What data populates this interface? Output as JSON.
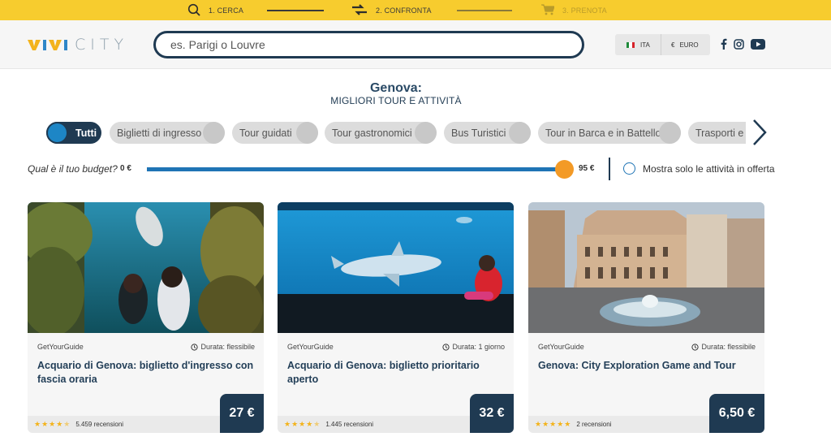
{
  "steps": [
    {
      "label": "1. CERCA",
      "icon": "search-icon"
    },
    {
      "label": "2. CONFRONTA",
      "icon": "compare-arrows-icon"
    },
    {
      "label": "3. PRENOTA",
      "icon": "cart-icon"
    }
  ],
  "logo": {
    "text": "CITY"
  },
  "search": {
    "placeholder": "es. Parigi o Louvre",
    "value": ""
  },
  "language": {
    "label": "ITA",
    "icon": "italy-flag-icon"
  },
  "currency": {
    "symbol": "€",
    "label": "EURO"
  },
  "social": [
    "facebook-icon",
    "instagram-icon",
    "youtube-icon"
  ],
  "heading": {
    "city": "Genova:",
    "subtitle": "MIGLIORI TOUR E ATTIVITÀ"
  },
  "categories": [
    {
      "label": "Tutti",
      "active": true
    },
    {
      "label": "Biglietti di ingresso",
      "active": false
    },
    {
      "label": "Tour guidati",
      "active": false
    },
    {
      "label": "Tour gastronomici",
      "active": false
    },
    {
      "label": "Bus Turistici",
      "active": false
    },
    {
      "label": "Tour in Barca e in Battello",
      "active": false
    },
    {
      "label": "Trasporti e Tr",
      "active": false
    }
  ],
  "budget": {
    "label": "Qual è il tuo budget?",
    "min": "0 €",
    "max": "95 €",
    "fill_fraction": 0.98
  },
  "offer_toggle": {
    "label": "Mostra solo le attività in offerta",
    "checked": false
  },
  "cards": [
    {
      "provider": "GetYourGuide",
      "duration": "Durata: flessibile",
      "title": "Acquario di Genova: biglietto d'ingresso con fascia oraria",
      "rating": 4.5,
      "reviews": "5.459 recensioni",
      "price": "27 €"
    },
    {
      "provider": "GetYourGuide",
      "duration": "Durata: 1 giorno",
      "title": "Acquario di Genova: biglietto prioritario aperto",
      "rating": 4.5,
      "reviews": "1.445 recensioni",
      "price": "32 €"
    },
    {
      "provider": "GetYourGuide",
      "duration": "Durata: flessibile",
      "title": "Genova: City Exploration Game and Tour",
      "rating": 5,
      "reviews": "2 recensioni",
      "price": "6,50 €"
    }
  ],
  "colors": {
    "yellow": "#f7cc2e",
    "navy": "#1f3a52",
    "blue": "#1f74b5",
    "orange": "#f39a26"
  }
}
